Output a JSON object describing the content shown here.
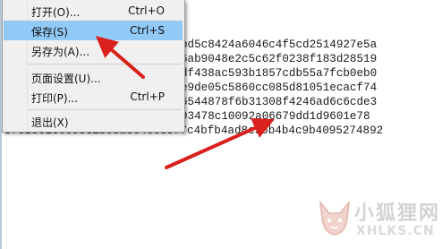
{
  "menu": {
    "items": [
      {
        "label": "打开(O)...",
        "shortcut": "Ctrl+O"
      },
      {
        "label": "保存(S)",
        "shortcut": "Ctrl+S"
      },
      {
        "label": "另存为(A)...",
        "shortcut": ""
      },
      {
        "label": "页面设置(U)...",
        "shortcut": ""
      },
      {
        "label": "打印(P)...",
        "shortcut": "Ctrl+P"
      },
      {
        "label": "退出(X)",
        "shortcut": ""
      }
    ],
    "selected_item": "保存(S)"
  },
  "document": {
    "lines": [
      "bd5c8424a6046c4f5cd2514927e5a",
      "6ab9048e2c5c62f0238f183d28519",
      "df438ac593b1857cdb55a7fcb0eb0",
      "e9de05c5860cc085d81051ecacf74",
      "6544878f6b31308f4246ad6c6cde3",
      "93478c10092a06679dd1d9601e78",
      "5fc2bc1c6698c2b08ac64c6e9f7c4bfb4ad8c36b4b4c9b4095274892"
    ]
  },
  "watermark": {
    "title": "小狐狸网",
    "url": "XHLKS.CN"
  },
  "colors": {
    "menu_background": "#f0f0f0",
    "selection": "#91c9f7",
    "arrow": "#d9201c",
    "text": "#1a1a1a"
  }
}
